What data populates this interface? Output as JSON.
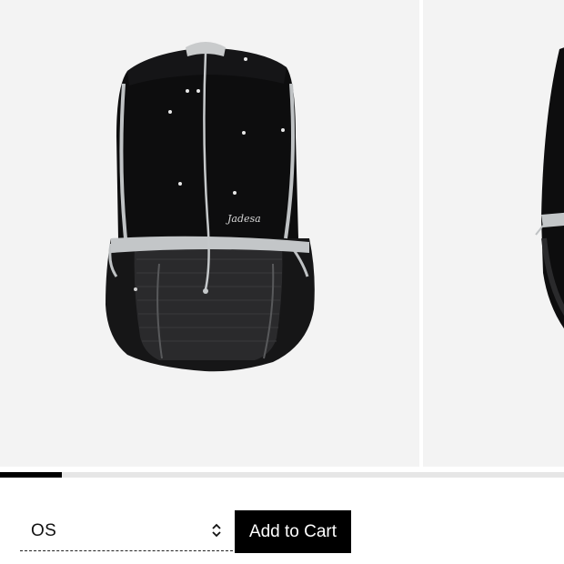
{
  "gallery": {
    "images": [
      {
        "subject": "black drawstring backpack, front view",
        "logo_text": "Jadesa"
      },
      {
        "subject": "black drawstring backpack, side view"
      }
    ],
    "progress_fraction": 0.11,
    "background_color": "#f3f3f3"
  },
  "product_form": {
    "size_select": {
      "selected_value": "OS",
      "icon": "chevron-up-down-icon"
    },
    "add_to_cart_label": "Add to Cart"
  },
  "colors": {
    "button_background": "#000000",
    "button_text": "#ffffff",
    "progress_fill": "#000000",
    "progress_track": "#e6e6e6"
  }
}
